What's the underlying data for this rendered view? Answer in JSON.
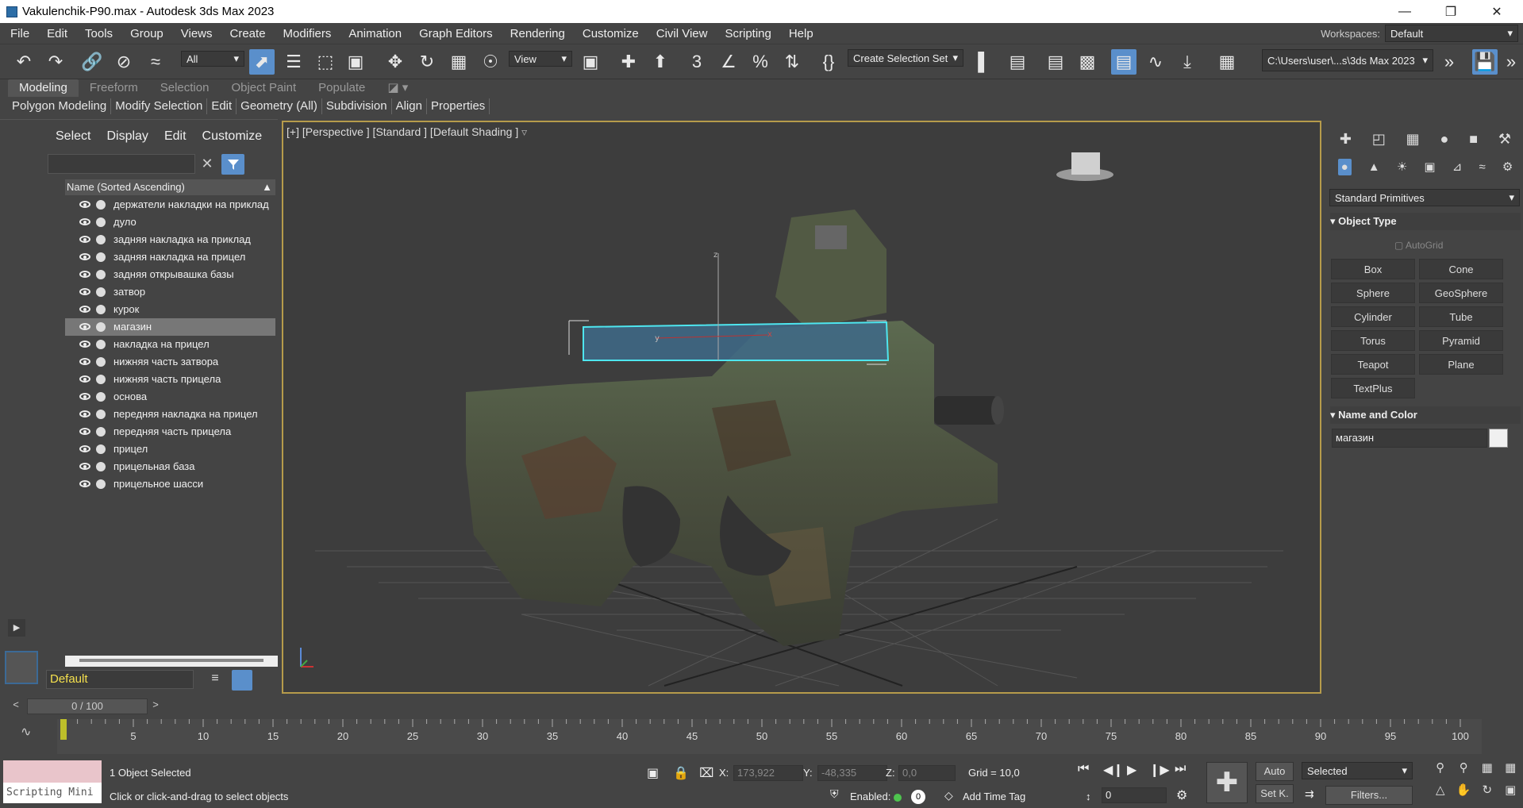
{
  "window": {
    "title": "Vakulenchik-P90.max - Autodesk 3ds Max 2023"
  },
  "menu": [
    "File",
    "Edit",
    "Tools",
    "Group",
    "Views",
    "Create",
    "Modifiers",
    "Animation",
    "Graph Editors",
    "Rendering",
    "Customize",
    "Civil View",
    "Scripting",
    "Help"
  ],
  "workspaces": {
    "label": "Workspaces:",
    "value": "Default"
  },
  "toolbar": {
    "selection_filter": "All",
    "ref_coord": "View",
    "selection_set": "Create Selection Set",
    "project_path": "C:\\Users\\user\\...s\\3ds Max 2023"
  },
  "ribbon": {
    "tabs": [
      "Modeling",
      "Freeform",
      "Selection",
      "Object Paint",
      "Populate"
    ],
    "panels": [
      "Polygon Modeling",
      "Modify Selection",
      "Edit",
      "Geometry (All)",
      "Subdivision",
      "Align",
      "Properties"
    ]
  },
  "scene_explorer": {
    "tabs": [
      "Select",
      "Display",
      "Edit",
      "Customize"
    ],
    "column_header": "Name (Sorted Ascending)",
    "items": [
      {
        "name": "держатели накладки на приклад"
      },
      {
        "name": "дуло"
      },
      {
        "name": "задняя накладка на приклад"
      },
      {
        "name": "задняя накладка на прицел"
      },
      {
        "name": "задняя открывашка базы"
      },
      {
        "name": "затвор"
      },
      {
        "name": "курок"
      },
      {
        "name": "магазин"
      },
      {
        "name": "накладка на прицел"
      },
      {
        "name": "нижняя часть затвора"
      },
      {
        "name": "нижняя часть прицела"
      },
      {
        "name": "основа"
      },
      {
        "name": "передняя накладка на прицел"
      },
      {
        "name": "передняя часть прицела"
      },
      {
        "name": "прицел"
      },
      {
        "name": "прицельная база"
      },
      {
        "name": "прицельное шасси"
      }
    ],
    "selected_item": "магазин",
    "layer": "Default"
  },
  "viewport": {
    "label": "[+] [Perspective ] [Standard ] [Default Shading ]"
  },
  "command_panel": {
    "category": "Standard Primitives",
    "object_type_title": "Object Type",
    "autogrid": "AutoGrid",
    "buttons": [
      "Box",
      "Cone",
      "Sphere",
      "GeoSphere",
      "Cylinder",
      "Tube",
      "Torus",
      "Pyramid",
      "Teapot",
      "Plane",
      "TextPlus"
    ],
    "name_color_title": "Name and Color",
    "object_name": "магазин"
  },
  "timeline": {
    "frame": "0 / 100",
    "ticks": [
      "0",
      "5",
      "10",
      "15",
      "20",
      "25",
      "30",
      "35",
      "40",
      "45",
      "50",
      "55",
      "60",
      "65",
      "70",
      "75",
      "80",
      "85",
      "90",
      "95",
      "100"
    ]
  },
  "status": {
    "selection": "1 Object Selected",
    "prompt": "Click or click-and-drag to select objects",
    "maxscript": "Scripting Mini",
    "x_label": "X:",
    "x": "173,922",
    "y_label": "Y:",
    "y": "-48,335",
    "z_label": "Z:",
    "z": "0,0",
    "grid": "Grid = 10,0",
    "enabled": "Enabled:",
    "enabled_value": "0",
    "add_time_tag": "Add Time Tag",
    "auto_key": "Auto",
    "set_key": "Set K.",
    "key_filter": "Selected",
    "filters": "Filters...",
    "current_frame": "0"
  },
  "colors": {
    "accent": "#5a8fcb",
    "viewport_border": "#b69b4b",
    "selection_bracket": "#4ee6ef",
    "selected_row": "#777777"
  }
}
